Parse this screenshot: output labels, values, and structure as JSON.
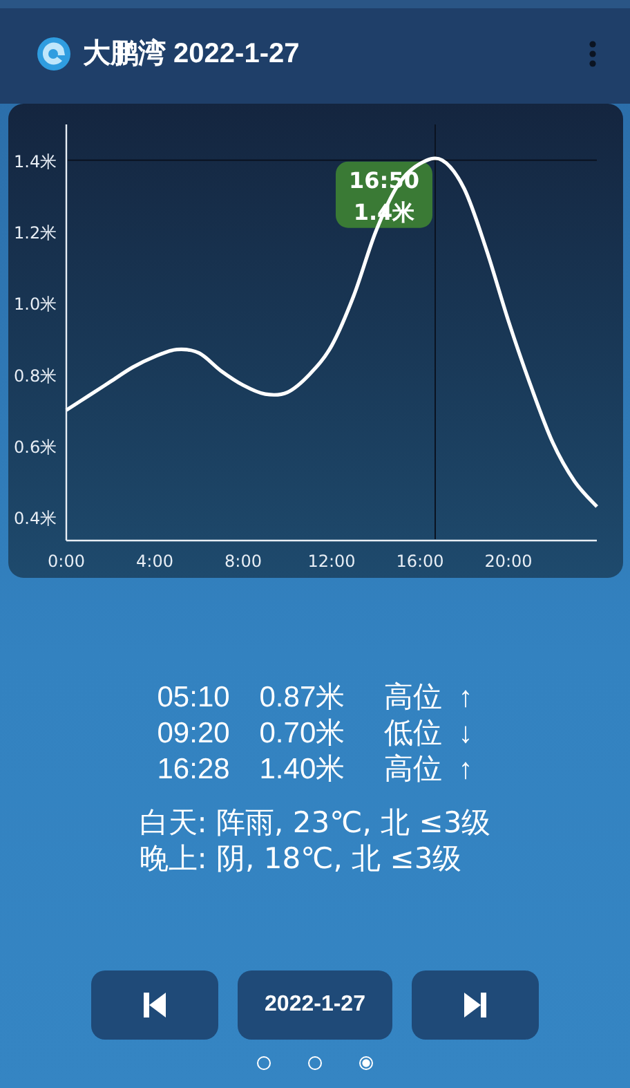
{
  "header": {
    "title": "大鹏湾 2022-1-27"
  },
  "chart": {
    "chart_data": {
      "type": "line",
      "x": [
        0,
        1,
        2,
        3,
        4,
        5,
        6,
        7,
        8,
        9,
        10,
        11,
        12,
        13,
        14,
        15,
        16,
        17,
        18,
        19,
        20,
        21,
        22,
        23,
        24
      ],
      "series": [
        {
          "color": "#ffffff",
          "values": [
            0.7,
            0.74,
            0.78,
            0.82,
            0.85,
            0.87,
            0.86,
            0.81,
            0.77,
            0.745,
            0.75,
            0.8,
            0.88,
            1.02,
            1.2,
            1.33,
            1.39,
            1.4,
            1.32,
            1.15,
            0.95,
            0.77,
            0.61,
            0.5,
            0.43
          ]
        }
      ],
      "xlim": [
        0,
        24
      ],
      "ylim": [
        0.335,
        1.5
      ],
      "xticks": [
        {
          "value": 0,
          "label": "0:00"
        },
        {
          "value": 4,
          "label": "4:00"
        },
        {
          "value": 8,
          "label": "8:00"
        },
        {
          "value": 12,
          "label": "12:00"
        },
        {
          "value": 16,
          "label": "16:00"
        },
        {
          "value": 20,
          "label": "20:00"
        }
      ],
      "yticks": [
        {
          "value": 0.4,
          "label": "0.4米"
        },
        {
          "value": 0.6,
          "label": "0.6米"
        },
        {
          "value": 0.8,
          "label": "0.8米"
        },
        {
          "value": 1.0,
          "label": "1.0米"
        },
        {
          "value": 1.2,
          "label": "1.2米"
        },
        {
          "value": 1.4,
          "label": "1.4米"
        }
      ]
    },
    "tooltip": {
      "time": "16:50",
      "value": "1.4米"
    }
  },
  "tides": [
    {
      "time": "05:10",
      "height": "0.87米",
      "type": "高位",
      "arrow": "↑"
    },
    {
      "time": "09:20",
      "height": "0.70米",
      "type": "低位",
      "arrow": "↓"
    },
    {
      "time": "16:28",
      "height": "1.40米",
      "type": "高位",
      "arrow": "↑"
    }
  ],
  "weather": [
    "白天: 阵雨, 23℃, 北 ≤3级",
    "晚上: 阴, 18℃, 北 ≤3级"
  ],
  "date_button": "2022-1-27",
  "pages": [
    {
      "selected": false
    },
    {
      "selected": false
    },
    {
      "selected": true
    }
  ]
}
